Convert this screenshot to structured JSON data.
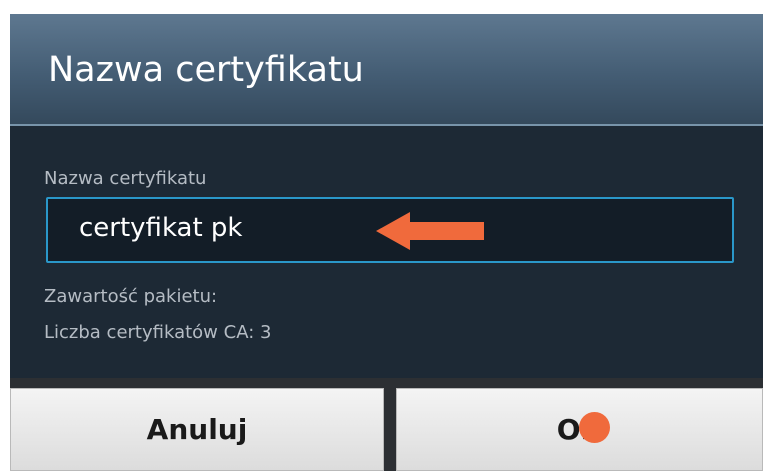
{
  "dialog": {
    "title": "Nazwa certyfikatu"
  },
  "form": {
    "field_label": "Nazwa certyfikatu",
    "field_value": "certyfikat pk",
    "package_contents_label": "Zawartość pakietu:",
    "ca_count_label": "Liczba certyfikatów CA: 3"
  },
  "buttons": {
    "cancel_label": "Anuluj",
    "ok_label": "OK"
  },
  "annotations": {
    "arrow_color": "#f06a3c",
    "dot_color": "#f06a3c"
  },
  "colors": {
    "accent_border": "#2a97c9",
    "dialog_background": "#1e2a36"
  }
}
